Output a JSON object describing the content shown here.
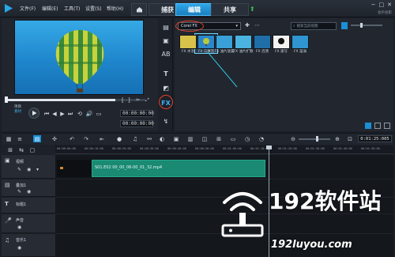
{
  "menu": {
    "items": [
      "文件(F)",
      "编辑(E)",
      "工具(T)",
      "设置(S)",
      "帮助(H)"
    ]
  },
  "tabs": [
    {
      "label": "捕获"
    },
    {
      "label": "编辑"
    },
    {
      "label": "共享"
    }
  ],
  "window": {
    "app_name": "会声会影"
  },
  "player": {
    "mode_label_project": "项目",
    "mode_label_clip": "素材",
    "timecode": "00:00:00:00"
  },
  "library": {
    "gallery_selected": "Corel FX",
    "search_placeholder": "搜索当前视图",
    "thumbnails": [
      {
        "label": "FX 水泡",
        "color": "#d8c24a"
      },
      {
        "label": "FX 马赛克",
        "color": "#2b86c9"
      },
      {
        "label": "FX 油片放置",
        "color": "#3aa0d8"
      },
      {
        "label": "FX 油片扩散",
        "color": "#4bb3e0"
      },
      {
        "label": "FX 涟漪",
        "color": "#1f6ea8"
      },
      {
        "label": "FX 速写",
        "color": "#f2f2f2"
      },
      {
        "label": "FX 漩涡",
        "color": "#2f94cf"
      }
    ]
  },
  "timeline": {
    "timecode": "0:01:25:005",
    "ruler_ticks": [
      "00:00:00:00",
      "00:00:10:00",
      "00:00:20:00",
      "00:00:30:00",
      "00:00:40:00",
      "00:00:50:00",
      "00:01:00:00",
      "00:01:10:00",
      "00:01:20:00",
      "00:01:30:00",
      "00:01:40:00",
      "00:01:50:00"
    ],
    "tracks": [
      {
        "name": "视频"
      },
      {
        "name": "叠加1"
      },
      {
        "name": "标题1"
      },
      {
        "name": "声音"
      },
      {
        "name": "音乐1"
      }
    ],
    "clip_label": "S01.E02 00_00_06-00_01_32.mp4"
  },
  "watermark": {
    "text": "192软件站",
    "url": "192luyou.com"
  },
  "colors": {
    "accent": "#1b8fd6",
    "clip": "#1a8a73",
    "highlight": "#e1402a"
  }
}
